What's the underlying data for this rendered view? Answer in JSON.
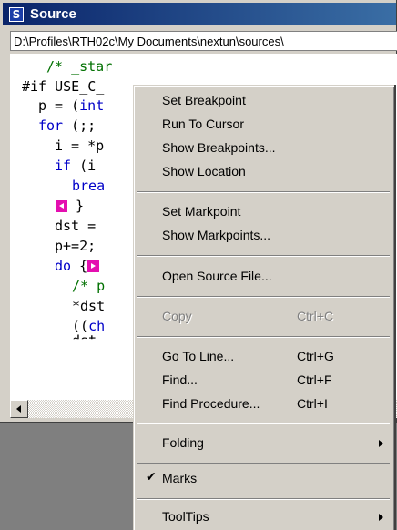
{
  "window": {
    "title": "Source",
    "icon_letter": "S",
    "path": "D:\\Profiles\\RTH02c\\My Documents\\nextun\\sources\\"
  },
  "code": {
    "line1_comment": "/* _star",
    "line2_kw": "#if",
    "line2_rest": " USE_C_",
    "line3_a": "p = (",
    "line3_kw": "int",
    "line4_kw": "for",
    "line4_rest": " (;;",
    "line5": "i = *p",
    "line6_kw": "if",
    "line6_rest": " (i",
    "line7_kw": "brea",
    "line8_rest": "}",
    "line9": "dst =",
    "line10": "p+=2;",
    "line11_kw": "do",
    "line11_rest": " {",
    "line12_comment": "/* p",
    "line13": "*dst",
    "line14_a": "((",
    "line14_kw": "ch",
    "line15": "dst"
  },
  "menu": {
    "set_breakpoint": "Set Breakpoint",
    "run_to_cursor": "Run To Cursor",
    "show_breakpoints": "Show Breakpoints...",
    "show_location": "Show Location",
    "set_markpoint": "Set Markpoint",
    "show_markpoints": "Show Markpoints...",
    "open_source_file": "Open Source File...",
    "copy": "Copy",
    "copy_shortcut": "Ctrl+C",
    "go_to_line": "Go To Line...",
    "go_to_line_shortcut": "Ctrl+G",
    "find": "Find...",
    "find_shortcut": "Ctrl+F",
    "find_procedure": "Find Procedure...",
    "find_procedure_shortcut": "Ctrl+I",
    "folding": "Folding",
    "marks": "Marks",
    "marks_checked": "✔",
    "tooltips": "ToolTips"
  },
  "colors": {
    "titlebar": "#0a246a",
    "keyword": "#0000c8",
    "comment": "#007000",
    "mark": "#e40fb0"
  },
  "icons": {
    "window_icon": "source-window-icon",
    "submenu_arrow": "submenu-arrow-icon",
    "scroll_left": "scroll-left-arrow-icon",
    "mark": "markpoint-icon"
  }
}
